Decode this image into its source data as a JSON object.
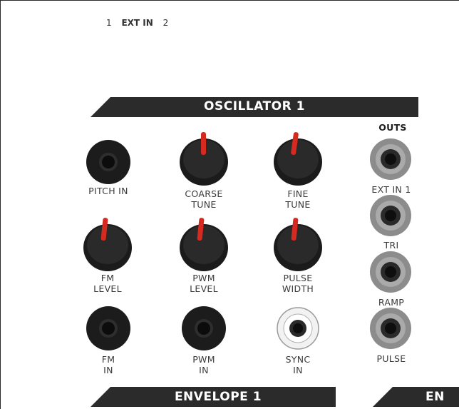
{
  "ext_in_selector": {
    "option_1": "1",
    "label": "EXT IN",
    "option_2": "2"
  },
  "sections": {
    "oscillator1": "OSCILLATOR 1",
    "envelope1": "ENVELOPE 1",
    "envelope_next": "EN"
  },
  "outs_label": "OUTS",
  "jacks": {
    "pitch_in": "PITCH IN",
    "fm_in": {
      "line1": "FM",
      "line2": "IN"
    },
    "pwm_in": {
      "line1": "PWM",
      "line2": "IN"
    },
    "sync_in": {
      "line1": "SYNC",
      "line2": "IN"
    },
    "out_ext_in_1": "EXT IN 1",
    "out_tri": "TRI",
    "out_ramp": "RAMP",
    "out_pulse": "PULSE"
  },
  "knobs": {
    "coarse_tune": {
      "line1": "COARSE",
      "line2": "TUNE"
    },
    "fine_tune": {
      "line1": "FINE",
      "line2": "TUNE"
    },
    "fm_level": {
      "line1": "FM",
      "line2": "LEVEL"
    },
    "pwm_level": {
      "line1": "PWM",
      "line2": "LEVEL"
    },
    "pulse_width": {
      "line1": "PULSE",
      "line2": "WIDTH"
    }
  },
  "colors": {
    "knob_indicator": "#d42a1f",
    "panel_header": "#2b2b2b",
    "knob_body": "#1b1b1b",
    "output_jack_ring": "#8c8c8c"
  }
}
